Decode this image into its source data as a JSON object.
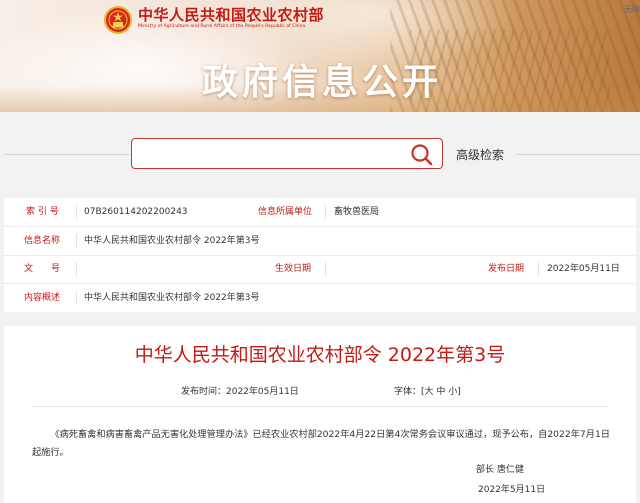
{
  "header": {
    "ministry_name": "中华人民共和国农业农村部",
    "ministry_name_en": "Ministry of Agriculture and Rural Affairs of the People's Republic of China",
    "accessibility_link": "无障",
    "section_title": "政府信息公开",
    "emblem_icon": "national-emblem-icon"
  },
  "search": {
    "placeholder": "",
    "value": "",
    "advanced_label": "高级检索",
    "icon": "search-icon"
  },
  "info": {
    "index_label": "索 引 号",
    "index_value": "07B260114202200243",
    "owner_label": "信息所属单位",
    "owner_value": "畜牧兽医局",
    "name_label": "信息名称",
    "name_value": "中华人民共和国农业农村部令 2022年第3号",
    "docno_label": "文　　号",
    "docno_value": "",
    "effective_label": "生效日期",
    "effective_value": "",
    "publish_label": "发布日期",
    "publish_value": "2022年05月11日",
    "summary_label": "内容概述",
    "summary_value": "中华人民共和国农业农村部令 2022年第3号"
  },
  "document": {
    "title": "中华人民共和国农业农村部令 2022年第3号",
    "publish_time": "发布时间：2022年05月11日",
    "font_size": "字体：[大 中 小]",
    "body": "《病死畜禽和病害畜禽产品无害化处理管理办法》已经农业农村部2022年4月22日第4次常务会议审议通过，现予公布，自2022年7月1日起施行。",
    "signer": "部长  唐仁健",
    "sign_date": "2022年5月11日"
  },
  "colors": {
    "brand_red": "#c41a14",
    "search_border": "#c8342b",
    "page_bg": "#f2f2f2"
  }
}
